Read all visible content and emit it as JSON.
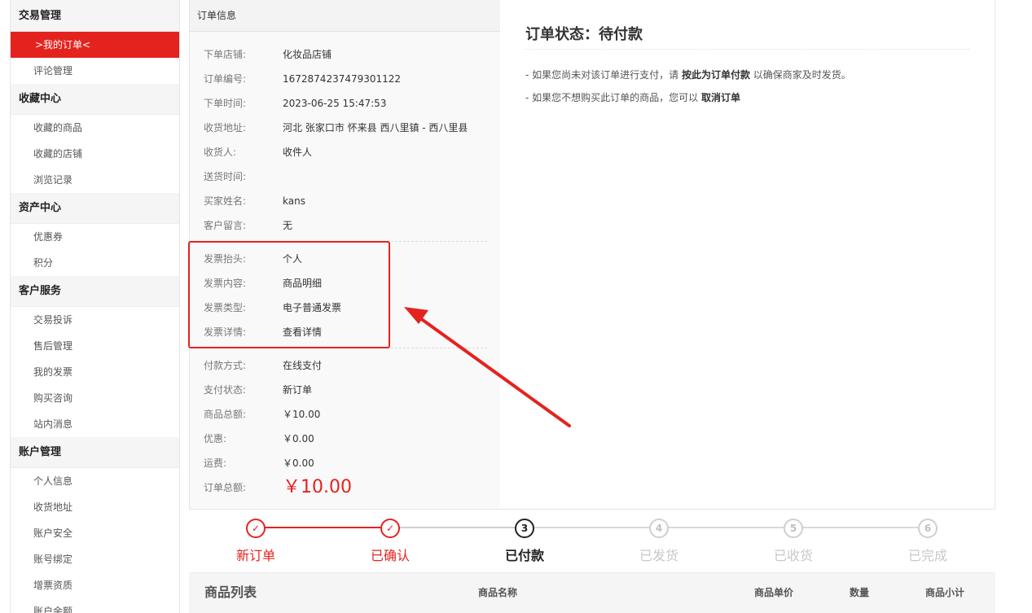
{
  "sidebar": {
    "sections": [
      {
        "title": "交易管理",
        "items": [
          {
            "label": ">我的订单<",
            "active": true
          },
          {
            "label": "评论管理",
            "active": false
          }
        ]
      },
      {
        "title": "收藏中心",
        "items": [
          {
            "label": "收藏的商品",
            "active": false
          },
          {
            "label": "收藏的店铺",
            "active": false
          },
          {
            "label": "浏览记录",
            "active": false
          }
        ]
      },
      {
        "title": "资产中心",
        "items": [
          {
            "label": "优惠券",
            "active": false
          },
          {
            "label": "积分",
            "active": false
          }
        ]
      },
      {
        "title": "客户服务",
        "items": [
          {
            "label": "交易投诉",
            "active": false
          },
          {
            "label": "售后管理",
            "active": false
          },
          {
            "label": "我的发票",
            "active": false
          },
          {
            "label": "购买咨询",
            "active": false
          },
          {
            "label": "站内消息",
            "active": false
          }
        ]
      },
      {
        "title": "账户管理",
        "items": [
          {
            "label": "个人信息",
            "active": false
          },
          {
            "label": "收货地址",
            "active": false
          },
          {
            "label": "账户安全",
            "active": false
          },
          {
            "label": "账号绑定",
            "active": false
          },
          {
            "label": "增票资质",
            "active": false
          },
          {
            "label": "账户余额",
            "active": false
          }
        ]
      }
    ]
  },
  "order_info": {
    "header": "订单信息",
    "basic": [
      {
        "label": "下单店铺:",
        "value": "化妆品店铺"
      },
      {
        "label": "订单编号:",
        "value": "1672874237479301122"
      },
      {
        "label": "下单时间:",
        "value": "2023-06-25 15:47:53"
      },
      {
        "label": "收货地址:",
        "value": "河北 张家口市 怀来县 西八里镇 - 西八里县"
      },
      {
        "label": "收货人:",
        "value": "收件人"
      },
      {
        "label": "送货时间:",
        "value": ""
      },
      {
        "label": "买家姓名:",
        "value": "kans"
      },
      {
        "label": "客户留言:",
        "value": "无"
      }
    ],
    "invoice": [
      {
        "label": "发票抬头:",
        "value": "个人"
      },
      {
        "label": "发票内容:",
        "value": "商品明细"
      },
      {
        "label": "发票类型:",
        "value": "电子普通发票"
      },
      {
        "label": "发票详情:",
        "value": "查看详情"
      }
    ],
    "payment": [
      {
        "label": "付款方式:",
        "value": "在线支付"
      },
      {
        "label": "支付状态:",
        "value": "新订单"
      },
      {
        "label": "商品总额:",
        "value": "￥10.00"
      },
      {
        "label": "优惠:",
        "value": "￥0.00"
      },
      {
        "label": "运费:",
        "value": "￥0.00"
      }
    ],
    "total": {
      "label": "订单总额:",
      "value": "￥10.00"
    }
  },
  "status": {
    "title": "订单状态：待付款",
    "tip1_prefix": "- 如果您尚未对该订单进行支付，请 ",
    "tip1_link": "按此为订单付款",
    "tip1_suffix": " 以确保商家及时发货。",
    "tip2_prefix": "- 如果您不想购买此订单的商品，您可以 ",
    "tip2_link": "取消订单"
  },
  "progress": {
    "steps": [
      {
        "num": "✓",
        "label": "新订单",
        "state": "done"
      },
      {
        "num": "✓",
        "label": "已确认",
        "state": "done"
      },
      {
        "num": "3",
        "label": "已付款",
        "state": "current"
      },
      {
        "num": "4",
        "label": "已发货",
        "state": "todo"
      },
      {
        "num": "5",
        "label": "已收货",
        "state": "todo"
      },
      {
        "num": "6",
        "label": "已完成",
        "state": "todo"
      }
    ]
  },
  "goods": {
    "title": "商品列表",
    "col_name": "商品名称",
    "col_price": "商品单价",
    "col_qty": "数量",
    "col_subtotal": "商品小计"
  },
  "colors": {
    "accent": "#e4231f"
  }
}
